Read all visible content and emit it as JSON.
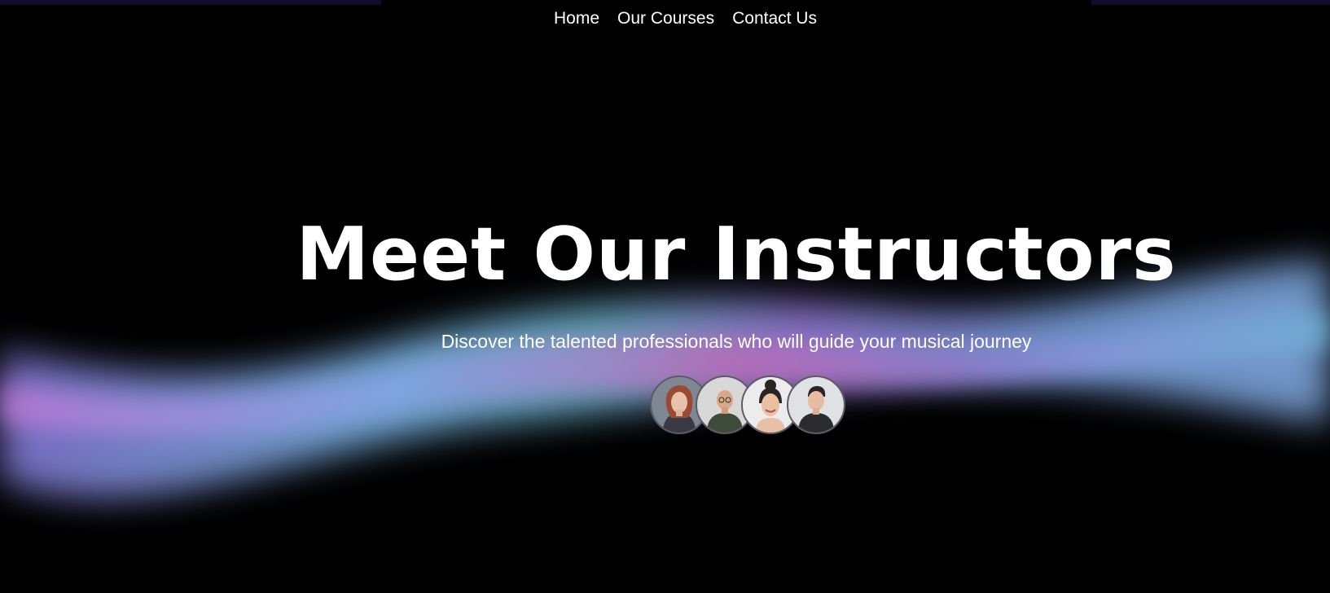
{
  "nav": {
    "items": [
      {
        "label": "Home"
      },
      {
        "label": "Our Courses"
      },
      {
        "label": "Contact Us"
      }
    ]
  },
  "hero": {
    "title": "Meet Our Instructors",
    "subtitle": "Discover the talented professionals who will guide your musical journey"
  },
  "instructors": [
    {
      "icon": "instructor-avatar-red-hair-woman"
    },
    {
      "icon": "instructor-avatar-bald-man-glasses"
    },
    {
      "icon": "instructor-avatar-smiling-woman-bun"
    },
    {
      "icon": "instructor-avatar-young-man"
    }
  ],
  "colors": {
    "background": "#000000",
    "text": "#ffffff",
    "wave_blue": "#7fa8e8",
    "wave_purple": "#a77ad8",
    "wave_teal": "#5fb6c8",
    "wave_pink": "#c46ab8"
  }
}
